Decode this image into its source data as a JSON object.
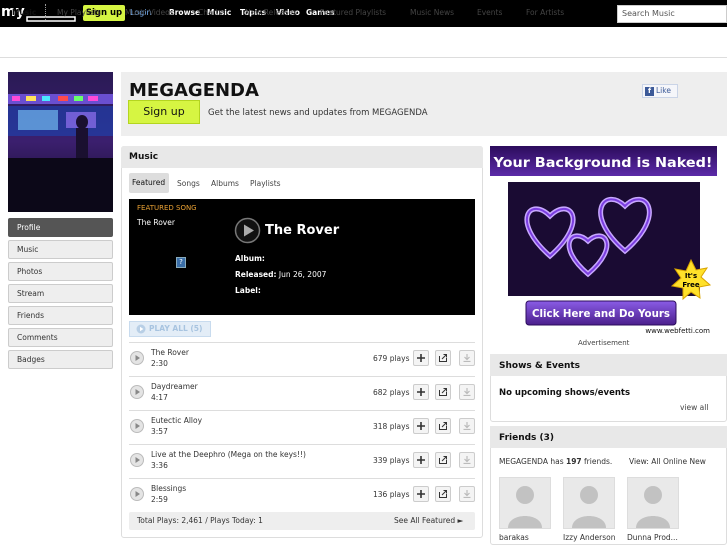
{
  "topbar": {
    "logo_text": "my",
    "signup_label": "Sign up",
    "login_label": "Login",
    "nav": [
      "Browse",
      "Music",
      "Topics",
      "Video",
      "Games"
    ],
    "search_placeholder": "Search Music"
  },
  "subnav": {
    "items": [
      "Music",
      "My Playlists",
      "Music Videos",
      "Charts",
      "New Releases",
      "Featured Playlists",
      "Music News",
      "Events",
      "For Artists"
    ]
  },
  "left_nav": {
    "items": [
      "Profile",
      "Music",
      "Photos",
      "Stream",
      "Friends",
      "Comments",
      "Badges"
    ],
    "active": "Profile"
  },
  "header": {
    "band_name": "MEGAGENDA",
    "signup_label": "Sign up",
    "tagline": "Get the latest news and updates from MEGAGENDA",
    "fb_like_label": "Like"
  },
  "music": {
    "title": "Music",
    "tabs": [
      "Featured",
      "Songs",
      "Albums",
      "Playlists"
    ],
    "active_tab": "Featured",
    "featured": {
      "label": "FEATURED SONG",
      "song_small": "The Rover",
      "image_placeholder": "?",
      "title": "The Rover",
      "album_label": "Album:",
      "album_value": "",
      "released_label": "Released:",
      "released_value": "Jun 26, 2007",
      "label_label": "Label:",
      "label_value": ""
    },
    "play_all_label": "PLAY ALL (5)",
    "tracks": [
      {
        "name": "The Rover",
        "duration": "2:30",
        "plays": "679 plays"
      },
      {
        "name": "Daydreamer",
        "duration": "4:17",
        "plays": "682 plays"
      },
      {
        "name": "Eutectic Alloy",
        "duration": "3:57",
        "plays": "318 plays"
      },
      {
        "name": "Live at the Deephro (Mega on the keys!!)",
        "duration": "3:36",
        "plays": "339 plays"
      },
      {
        "name": "Blessings",
        "duration": "2:59",
        "plays": "136 plays"
      }
    ],
    "totals": "Total Plays: 2,461 / Plays Today: 1",
    "see_all": "See All Featured ►"
  },
  "ad": {
    "headline": "Your Background is Naked!",
    "cta": "Click Here and Do Yours",
    "badge_line1": "It's",
    "badge_line2": "Free",
    "url": "www.webfetti.com",
    "caption": "Advertisement"
  },
  "shows": {
    "title": "Shows & Events",
    "empty_text": "No upcoming shows/events",
    "view_all": "view all"
  },
  "friends": {
    "title": "Friends (3)",
    "count_prefix": "MEGAGENDA has ",
    "count_number": "197",
    "count_suffix": " friends.",
    "view_text": "View:  All  Online  New",
    "list": [
      "barakas",
      "Izzy Anderson",
      "Dunna Prod..."
    ]
  },
  "colors": {
    "accent_green": "#d6f542",
    "featured_orange": "#e8a033",
    "ad_purple": "#4b1f8c"
  }
}
